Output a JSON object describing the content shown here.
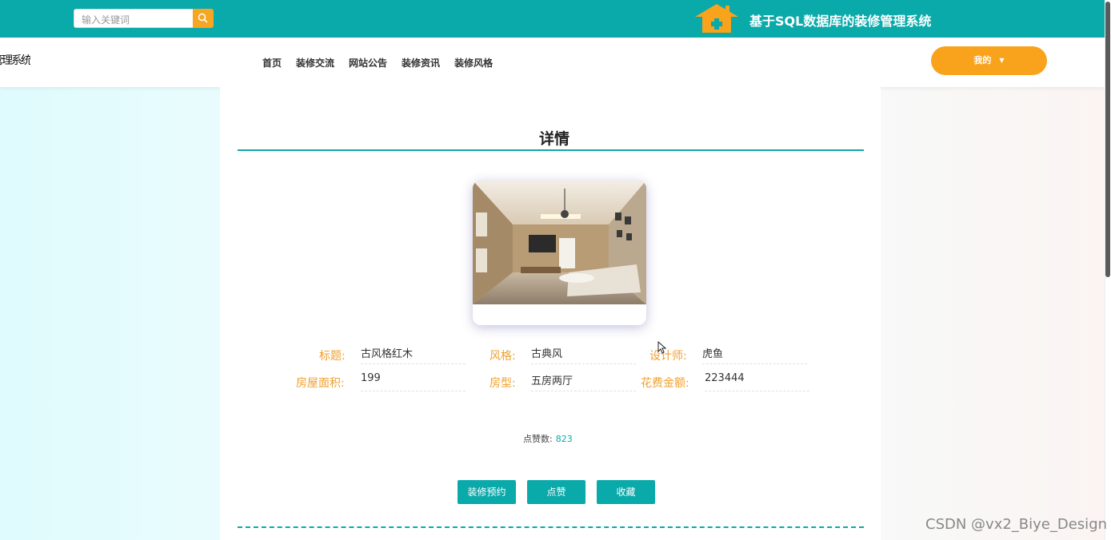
{
  "header": {
    "search_placeholder": "输入关键词",
    "site_title": "基于SQL数据库的装修管理系统"
  },
  "nav": {
    "brand": "装修管理系统",
    "links": [
      "首页",
      "装修交流",
      "网站公告",
      "装修资讯",
      "装修风格"
    ],
    "my_label": "我的"
  },
  "detail": {
    "heading": "详情",
    "fields": {
      "title_label": "标题:",
      "title_value": "古风格红木",
      "style_label": "风格:",
      "style_value": "古典风",
      "designer_label": "设计师:",
      "designer_value": "虎鱼",
      "area_label": "房屋面积:",
      "area_value": "199",
      "layout_label": "房型:",
      "layout_value": "五房两厅",
      "cost_label": "花费金额:",
      "cost_value": "223444"
    },
    "likes_label": "点赞数:",
    "likes_value": "823",
    "buttons": {
      "reserve": "装修预约",
      "like": "点赞",
      "favorite": "收藏"
    }
  },
  "watermark": "CSDN @vx2_Biye_Design",
  "colors": {
    "primary": "#0aa9aa",
    "accent": "#f9a21b",
    "label": "#f0a030"
  }
}
